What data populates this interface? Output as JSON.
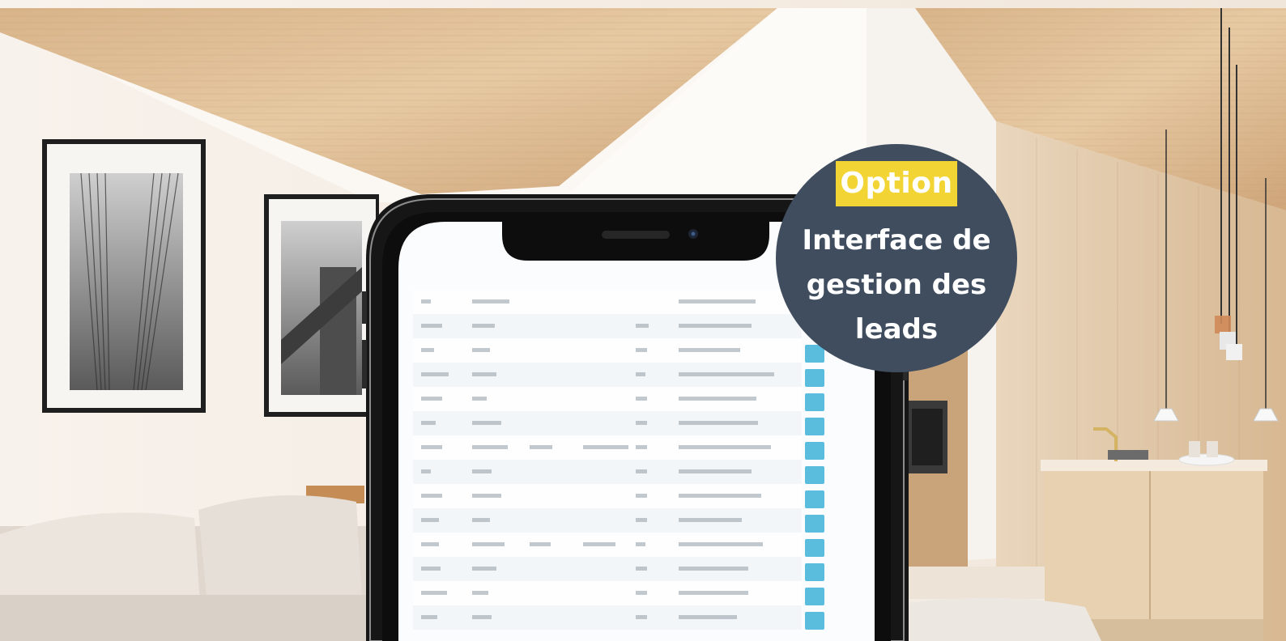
{
  "callout": {
    "tag": "Option",
    "lines": [
      "Interface de",
      "gestion des",
      "leads"
    ],
    "colors": {
      "badge": "#3f4d5f",
      "tag": "#f2d534",
      "text": "#ffffff"
    }
  },
  "scene": {
    "subject": "smartphone-displaying-leads-table",
    "icons": [
      "framed-photo-icon",
      "framed-photo-icon",
      "pendant-lamp-icon",
      "sofa-icon",
      "kitchen-island-icon",
      "smartphone-icon"
    ]
  }
}
